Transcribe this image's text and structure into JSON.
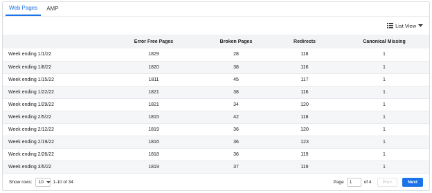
{
  "tabs": [
    {
      "label": "Web Pages",
      "active": true
    },
    {
      "label": "AMP",
      "active": false
    }
  ],
  "toolbar": {
    "view_label": "List View",
    "view_icon": "list-icon"
  },
  "table": {
    "headers": [
      "",
      "Error Free Pages",
      "Broken Pages",
      "Redirects",
      "Canonical Missing"
    ],
    "rows": [
      [
        "Week ending 1/1/22",
        "1829",
        "28",
        "118",
        "1"
      ],
      [
        "Week ending 1/8/22",
        "1820",
        "38",
        "116",
        "1"
      ],
      [
        "Week ending 1/15/22",
        "1811",
        "45",
        "117",
        "1"
      ],
      [
        "Week ending 1/22/22",
        "1821",
        "38",
        "116",
        "1"
      ],
      [
        "Week ending 1/29/22",
        "1821",
        "34",
        "120",
        "1"
      ],
      [
        "Week ending 2/5/22",
        "1815",
        "42",
        "118",
        "1"
      ],
      [
        "Week ending 2/12/22",
        "1819",
        "36",
        "120",
        "1"
      ],
      [
        "Week ending 2/19/22",
        "1816",
        "36",
        "123",
        "1"
      ],
      [
        "Week ending 2/26/22",
        "1818",
        "36",
        "119",
        "1"
      ],
      [
        "Week ending 3/5/22",
        "1819",
        "37",
        "119",
        "1"
      ]
    ]
  },
  "pagination": {
    "show_rows_label": "Show rows:",
    "rows_value": "10",
    "range_text": "1-10 of 34",
    "page_label": "Page",
    "page_value": "1",
    "of_text": "of 4",
    "prev_label": "Prev",
    "next_label": "Next"
  },
  "colors": {
    "accent": "#1a73e8",
    "header_bg": "#f1f3f4",
    "stripe_bg": "#f5f6f7"
  }
}
